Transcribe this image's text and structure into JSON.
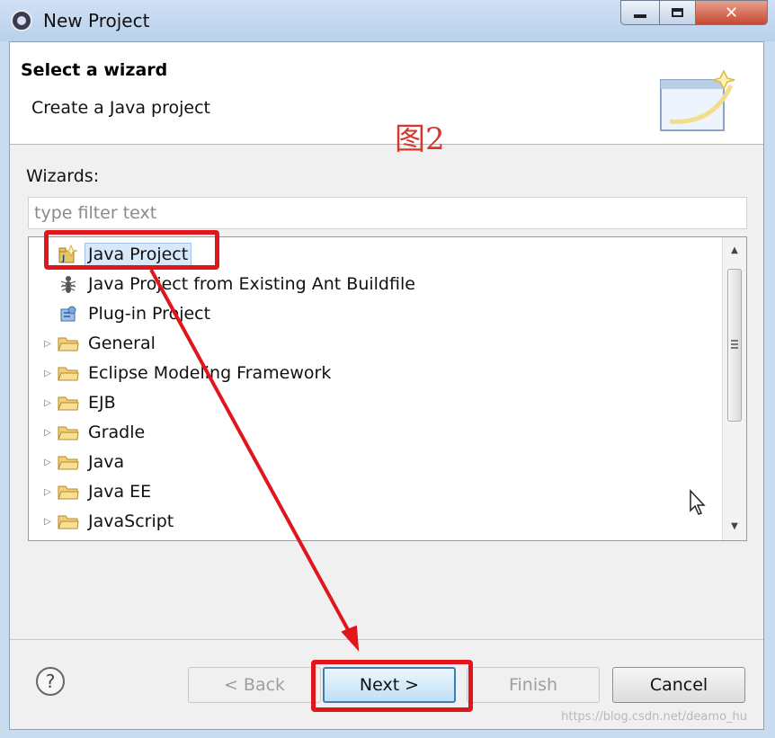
{
  "window": {
    "title": "New Project",
    "close_glyph": "✕",
    "icon": "eclipse-icon"
  },
  "banner": {
    "title": "Select a wizard",
    "subtitle": "Create a Java project",
    "annotation": "图2",
    "image_icon": "wizard-banner-icon"
  },
  "wizards": {
    "label": "Wizards:",
    "filter_placeholder": "type filter text",
    "filter_value": "",
    "items": [
      {
        "label": "Java Project",
        "icon": "java-project-icon",
        "expandable": false,
        "selected": true
      },
      {
        "label": "Java Project from Existing Ant Buildfile",
        "icon": "ant-icon",
        "expandable": false,
        "selected": false
      },
      {
        "label": "Plug-in Project",
        "icon": "plugin-project-icon",
        "expandable": false,
        "selected": false
      },
      {
        "label": "General",
        "icon": "folder-icon",
        "expandable": true,
        "selected": false
      },
      {
        "label": "Eclipse Modeling Framework",
        "icon": "folder-icon",
        "expandable": true,
        "selected": false
      },
      {
        "label": "EJB",
        "icon": "folder-icon",
        "expandable": true,
        "selected": false
      },
      {
        "label": "Gradle",
        "icon": "folder-icon",
        "expandable": true,
        "selected": false
      },
      {
        "label": "Java",
        "icon": "folder-icon",
        "expandable": true,
        "selected": false
      },
      {
        "label": "Java EE",
        "icon": "folder-icon",
        "expandable": true,
        "selected": false
      },
      {
        "label": "JavaScript",
        "icon": "folder-icon",
        "expandable": true,
        "selected": false
      }
    ]
  },
  "buttons": {
    "back": "< Back",
    "next": "Next >",
    "finish": "Finish",
    "cancel": "Cancel",
    "help": "?"
  },
  "watermark": "https://blog.csdn.net/deamo_hu",
  "colors": {
    "highlight_red": "#e1161c",
    "annotation_red": "#d8382c",
    "selection_blue": "#d8e8fb",
    "default_button_border": "#3c7fb1"
  }
}
